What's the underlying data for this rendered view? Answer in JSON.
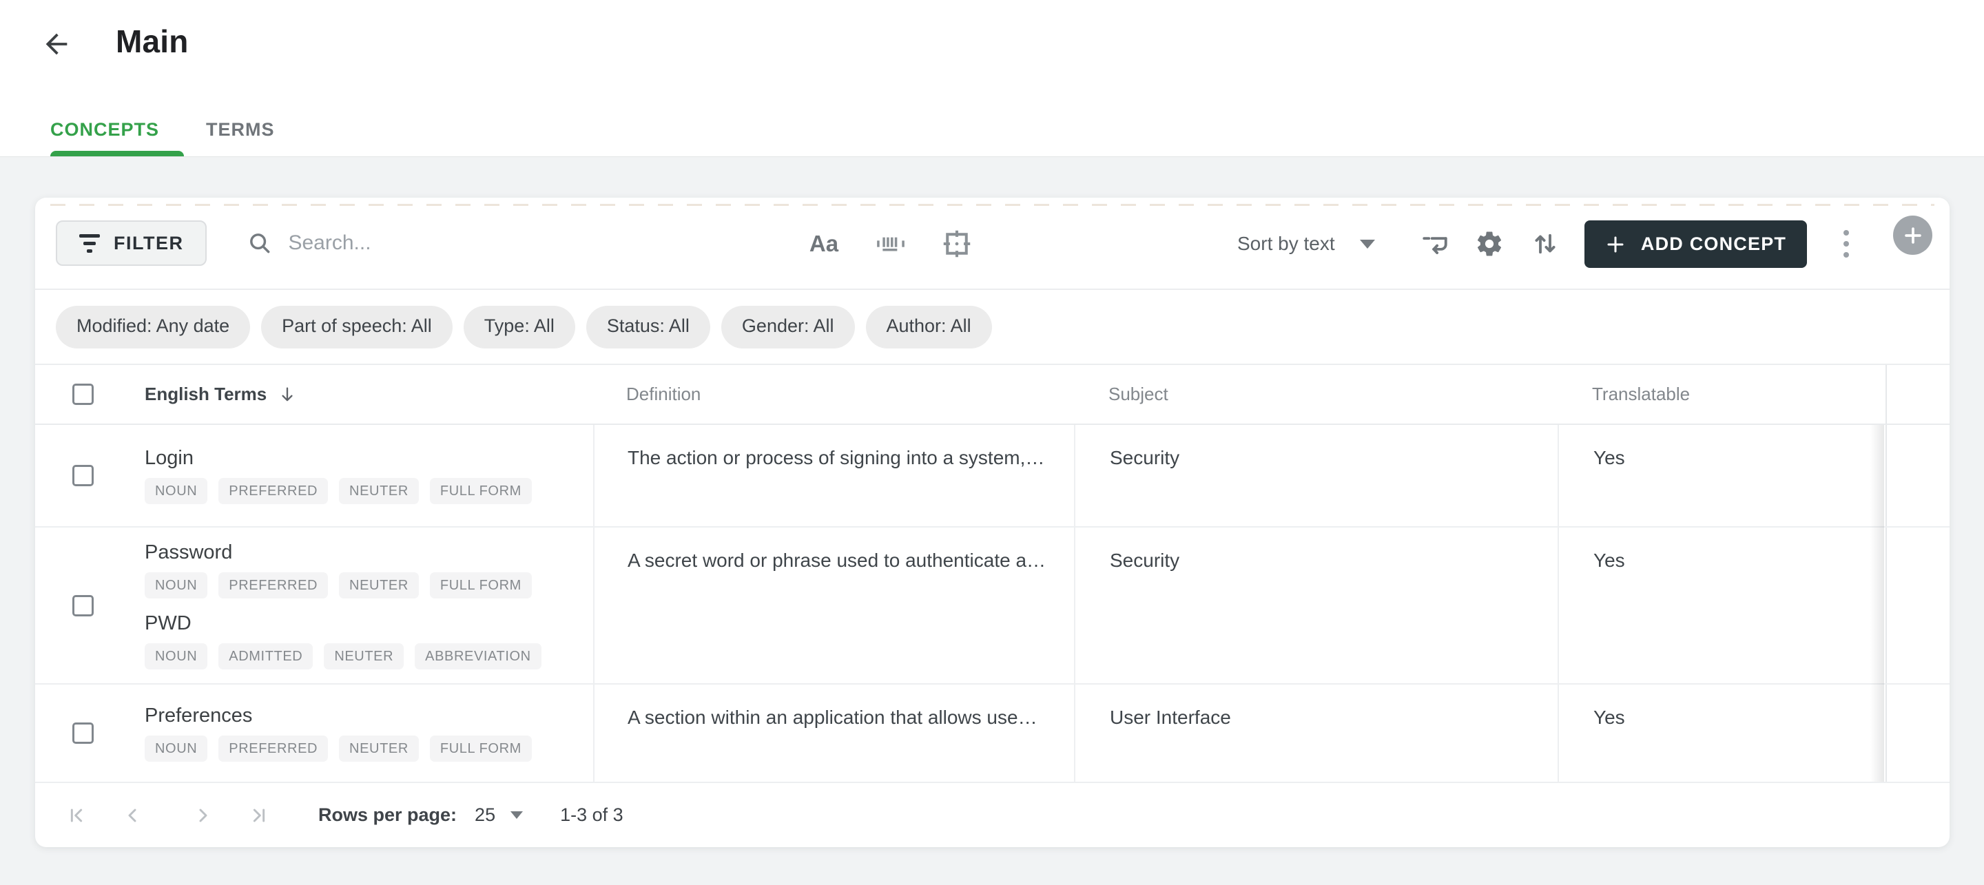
{
  "header": {
    "title": "Main",
    "back_icon": "arrow-left-icon"
  },
  "tabs": [
    {
      "label": "CONCEPTS",
      "active": true
    },
    {
      "label": "TERMS",
      "active": false
    }
  ],
  "toolbar": {
    "filter_label": "FILTER",
    "search_placeholder": "Search...",
    "search_value": "",
    "match_case_icon": "Aa",
    "sort_label": "Sort by text",
    "add_concept_label": "ADD CONCEPT",
    "icons": [
      "search-icon",
      "match-case-icon",
      "barcode-icon",
      "crosshair-icon",
      "wrap-text-icon",
      "gear-icon",
      "sort-arrows-icon",
      "more-vert-icon",
      "add-circle-icon"
    ]
  },
  "filter_chips": [
    "Modified: Any date",
    "Part of speech: All",
    "Type: All",
    "Status: All",
    "Gender: All",
    "Author: All"
  ],
  "table": {
    "columns": [
      "English Terms",
      "Definition",
      "Subject",
      "Translatable"
    ],
    "sort_column": "English Terms",
    "sort_icon": "arrow-down-icon",
    "rows": [
      {
        "terms": [
          {
            "text": "Login",
            "tags": [
              "NOUN",
              "PREFERRED",
              "NEUTER",
              "FULL FORM"
            ]
          }
        ],
        "definition": "The action or process of signing into a system,…",
        "subject": "Security",
        "translatable": "Yes"
      },
      {
        "terms": [
          {
            "text": "Password",
            "tags": [
              "NOUN",
              "PREFERRED",
              "NEUTER",
              "FULL FORM"
            ]
          },
          {
            "text": "PWD",
            "tags": [
              "NOUN",
              "ADMITTED",
              "NEUTER",
              "ABBREVIATION"
            ]
          }
        ],
        "definition": "A secret word or phrase used to authenticate a…",
        "subject": "Security",
        "translatable": "Yes"
      },
      {
        "terms": [
          {
            "text": "Preferences",
            "tags": [
              "NOUN",
              "PREFERRED",
              "NEUTER",
              "FULL FORM"
            ]
          }
        ],
        "definition": "A section within an application that allows use…",
        "subject": "User Interface",
        "translatable": "Yes"
      }
    ]
  },
  "footer": {
    "rows_per_page_label": "Rows per page:",
    "rows_per_page_value": "25",
    "range_label": "1-3 of 3",
    "nav_icons": [
      "first-page-icon",
      "prev-page-icon",
      "next-page-icon",
      "last-page-icon"
    ]
  },
  "colors": {
    "accent_green": "#34a14a",
    "dark_button": "#263238",
    "page_background": "#f1f3f4",
    "chip_background": "#ececec",
    "tag_background": "#f4f4f5",
    "text_dark": "#3c4043",
    "text_gray": "#82878c"
  }
}
